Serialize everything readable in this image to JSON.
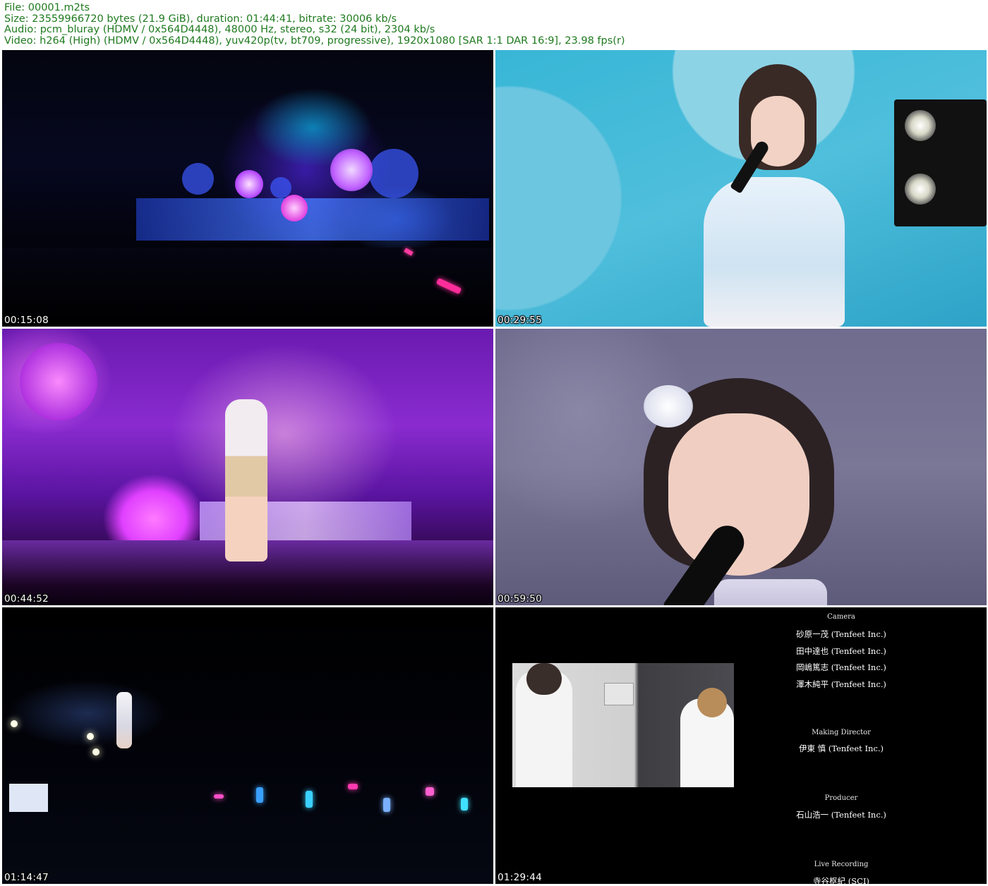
{
  "header": {
    "line1": "File: 00001.m2ts",
    "line2": "Size: 23559966720 bytes (21.9 GiB), duration: 01:44:41, bitrate: 30006 kb/s",
    "line3": "Audio: pcm_bluray (HDMV / 0x564D4448), 48000 Hz, stereo, s32 (24 bit), 2304 kb/s",
    "line4": "Video: h264 (High) (HDMV / 0x564D4448), yuv420p(tv, bt709, progressive), 1920x1080 [SAR 1:1 DAR 16:9], 23.98 fps(r)"
  },
  "colors": {
    "header_text": "#1f7a1f",
    "background": "#ffffff",
    "timestamp_text": "#ffffff"
  },
  "thumbnails": [
    {
      "timestamp": "00:15:08",
      "scene": "stage-wide-shot"
    },
    {
      "timestamp": "00:29:55",
      "scene": "singer-with-microphone"
    },
    {
      "timestamp": "00:44:52",
      "scene": "purple-stage-performance"
    },
    {
      "timestamp": "00:59:50",
      "scene": "singer-close-up"
    },
    {
      "timestamp": "01:14:47",
      "scene": "crowd-with-glowsticks"
    },
    {
      "timestamp": "01:29:44",
      "scene": "end-credits"
    }
  ],
  "credits": {
    "camera_role": "Camera",
    "camera_names": [
      "砂原一茂 (Tenfeet Inc.)",
      "田中達也 (Tenfeet Inc.)",
      "岡嶋篤志 (Tenfeet Inc.)",
      "澤木純平 (Tenfeet Inc.)"
    ],
    "making_director_role": "Making Director",
    "making_director_name": "伊東 慎 (Tenfeet Inc.)",
    "producer_role": "Producer",
    "producer_name": "石山浩一 (Tenfeet Inc.)",
    "live_recording_role": "Live Recording",
    "live_recording_name": "寺谷枢紀 (SCI)"
  }
}
